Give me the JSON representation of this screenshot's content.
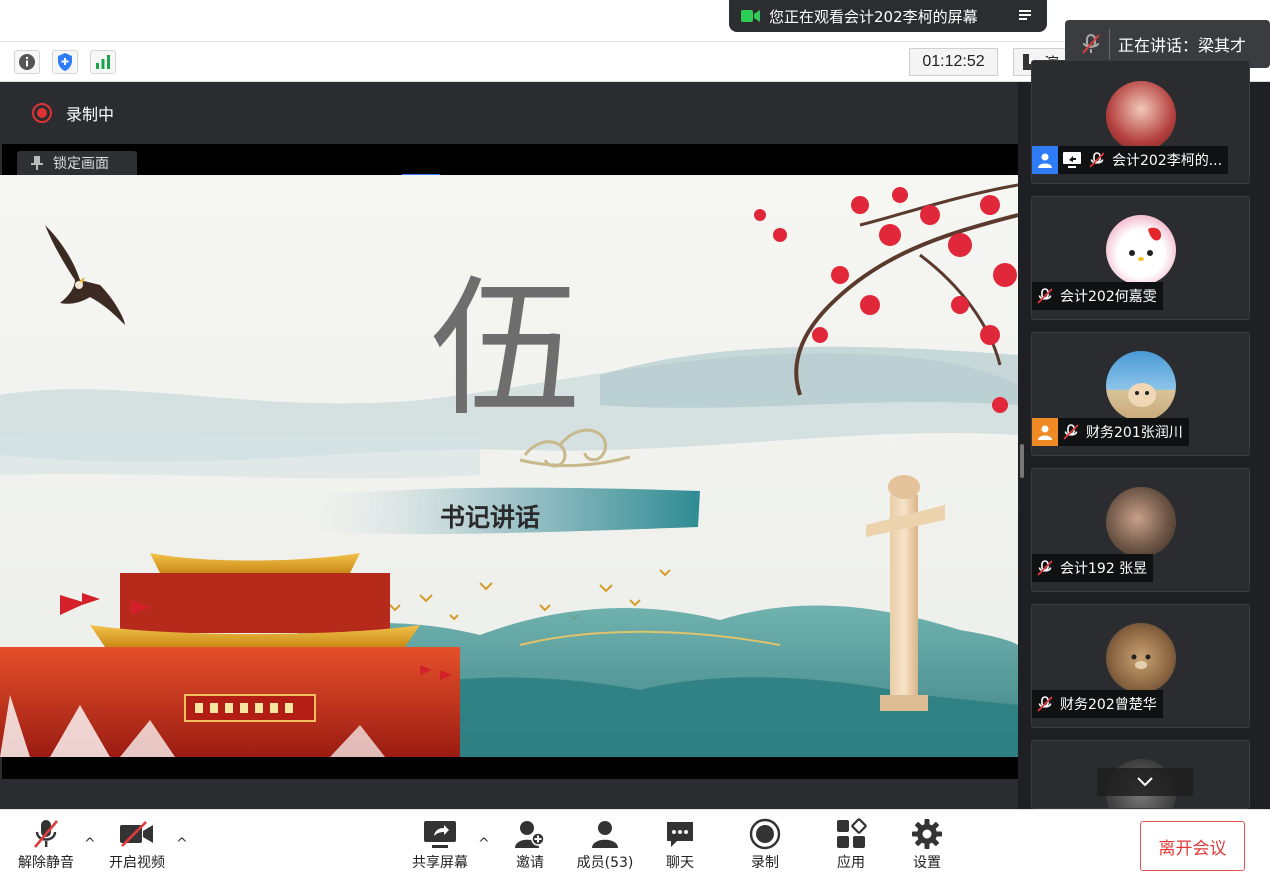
{
  "notice": {
    "watching": "您正在观看会计202李柯的屏幕",
    "speaking_label": "正在讲话：梁其才"
  },
  "toolbar": {
    "timer": "01:12:52",
    "view_label": "演"
  },
  "recording": {
    "status": "录制中",
    "lock_label": "锁定画面"
  },
  "slide": {
    "heading": "伍",
    "subtitle": "书记讲话",
    "gate_sign": "中华人民共和国万岁"
  },
  "participants": [
    {
      "name": "会计202李柯的...",
      "role": "host",
      "role_color": "#2e7cf6",
      "sharing": true
    },
    {
      "name": "会计202何嘉雯",
      "role": "",
      "sharing": false
    },
    {
      "name": "财务201张润川",
      "role": "cohost",
      "role_color": "#f08a24",
      "sharing": false
    },
    {
      "name": "会计192 张昱",
      "role": "",
      "sharing": false
    },
    {
      "name": "财务202曾楚华",
      "role": "",
      "sharing": false
    }
  ],
  "bottom": {
    "unmute": "解除静音",
    "start_video": "开启视频",
    "share_screen": "共享屏幕",
    "invite": "邀请",
    "members": "成员(53)",
    "chat": "聊天",
    "record": "录制",
    "apps": "应用",
    "settings": "设置",
    "leave": "离开会议"
  },
  "colors": {
    "accent_red": "#e03b3b",
    "dark_bg": "#2a2c30",
    "signal_green": "#1aa34a",
    "shield_blue": "#2e7cf6"
  }
}
